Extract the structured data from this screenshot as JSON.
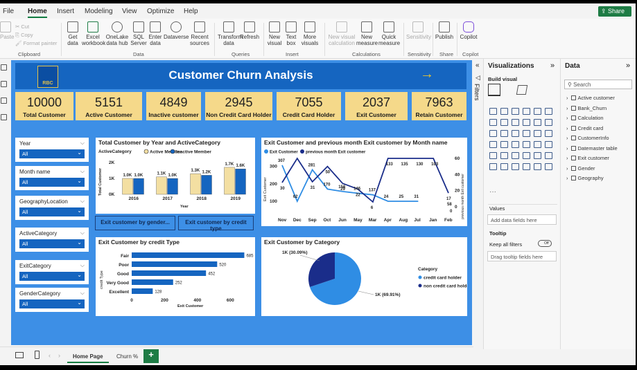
{
  "menu": {
    "file": "File",
    "home": "Home",
    "insert": "Insert",
    "modeling": "Modeling",
    "view": "View",
    "optimize": "Optimize",
    "help": "Help",
    "share": "Share"
  },
  "ribbon": {
    "clipboard": {
      "paste": "Paste",
      "cut": "Cut",
      "copy": "Copy",
      "format_painter": "Format painter",
      "group": "Clipboard"
    },
    "data": {
      "get_data": "Get data",
      "excel": "Excel workbook",
      "onelake": "OneLake data hub",
      "sql": "SQL Server",
      "enter": "Enter data",
      "dataverse": "Dataverse",
      "recent": "Recent sources",
      "group": "Data"
    },
    "queries": {
      "transform": "Transform data",
      "refresh": "Refresh",
      "group": "Queries"
    },
    "insert": {
      "new_visual": "New visual",
      "text_box": "Text box",
      "more_visuals": "More visuals",
      "group": "Insert"
    },
    "calculations": {
      "new_visual_calc": "New visual calculation",
      "new_measure": "New measure",
      "quick_measure": "Quick measure",
      "group": "Calculations"
    },
    "sensitivity": {
      "label": "Sensitivity",
      "group": "Sensitivity"
    },
    "share": {
      "publish": "Publish",
      "group": "Share"
    },
    "copilot": {
      "label": "Copilot",
      "group": "Copilot"
    }
  },
  "report": {
    "title": "Customer Churn Analysis",
    "logo_text": "RBC",
    "kpis": [
      {
        "value": "10000",
        "label": "Total Customer"
      },
      {
        "value": "5151",
        "label": "Active Customer"
      },
      {
        "value": "4849",
        "label": "Inactive customer"
      },
      {
        "value": "2945",
        "label": "Non Credit Card Holder"
      },
      {
        "value": "7055",
        "label": "Credit Card Holder"
      },
      {
        "value": "2037",
        "label": "Exit Customer"
      },
      {
        "value": "7963",
        "label": "Retain Customer"
      }
    ],
    "slicers": [
      {
        "title": "Year",
        "value": "All"
      },
      {
        "title": "Month name",
        "value": "All"
      },
      {
        "title": "GeographyLocation",
        "value": "All"
      },
      {
        "title": "ActiveCategory",
        "value": "All"
      },
      {
        "title": "ExitCategory",
        "value": "All"
      },
      {
        "title": "GenderCategory",
        "value": "All"
      }
    ],
    "buttons": {
      "by_gender": "Exit customer by gender...",
      "by_credit": "Exit customer by credit type"
    }
  },
  "chart_data": [
    {
      "type": "bar",
      "title": "Total Customer by Year and ActiveCategory",
      "legend_title": "ActiveCategory",
      "categories": [
        "2016",
        "2017",
        "2018",
        "2019"
      ],
      "series": [
        {
          "name": "Active Member",
          "values": [
            1.0,
            1.1,
            1.3,
            1.7
          ],
          "labels": [
            "1.0K",
            "1.1K",
            "1.3K",
            "1.7K"
          ],
          "color": "#f3dfa2"
        },
        {
          "name": "Inactive Member",
          "values": [
            1.0,
            1.0,
            1.2,
            1.6
          ],
          "labels": [
            "1.0K",
            "1.0K",
            "1.2K",
            "1.6K"
          ],
          "color": "#1565c0"
        }
      ],
      "xlabel": "Year",
      "ylabel": "Total Customer",
      "yticks": [
        "0K",
        "1K",
        "2K"
      ],
      "ylim": [
        0,
        2
      ]
    },
    {
      "type": "line",
      "title": "Exit Customer and previous month Exit customer by Month name",
      "categories": [
        "Nov",
        "Dec",
        "Sep",
        "Oct",
        "Jun",
        "May",
        "Mar",
        "Apr",
        "Aug",
        "Jul",
        "Jan",
        "Feb"
      ],
      "series": [
        {
          "name": "Exit Customer",
          "axis": "left",
          "values": [
            307,
            62,
            281,
            170,
            156,
            146,
            137,
            24,
            25,
            31,
            null,
            null
          ],
          "labels": [
            "307",
            "62",
            "281",
            "170",
            "156",
            "146",
            "137",
            "24",
            "25",
            "31",
            "",
            ""
          ],
          "color": "#2f8de4"
        },
        {
          "name": "previous month Exit customer",
          "axis": "right",
          "values": [
            30,
            62,
            31,
            50,
            29,
            22,
            6,
            133,
            135,
            130,
            103,
            17
          ],
          "labels": [
            "30",
            "",
            "31",
            "50",
            "29",
            "22",
            "6",
            "133",
            "135",
            "130",
            "103",
            "17"
          ],
          "color": "#1a2d8a"
        }
      ],
      "extra_labels": [
        "58",
        "0"
      ],
      "ylabel": "Exit Customer",
      "y2label": "previous month Exit customer",
      "yticks": [
        "100",
        "200",
        "300"
      ],
      "y2ticks": [
        "0",
        "20",
        "40",
        "60"
      ],
      "ylim": [
        100,
        300
      ],
      "y2lim": [
        0,
        60
      ]
    },
    {
      "type": "bar",
      "orientation": "horizontal",
      "title": "Exit Customer by credit Type",
      "categories": [
        "Fair",
        "Poor",
        "Good",
        "Very Good",
        "Excellent"
      ],
      "values": [
        685,
        520,
        452,
        252,
        128
      ],
      "xlabel": "Exit Customer",
      "ylabel": "credit Type",
      "xticks": [
        "0",
        "200",
        "400",
        "600"
      ],
      "xlim": [
        0,
        700
      ],
      "color": "#1565c0"
    },
    {
      "type": "pie",
      "title": "Exit Customer by Category",
      "legend_title": "Category",
      "slices": [
        {
          "name": "credit card holder",
          "value": 69.91,
          "label": "1K (69.91%)",
          "color": "#2f8de4"
        },
        {
          "name": "non credit card holder",
          "value": 30.09,
          "label": "1K (30.09%)",
          "color": "#1a2d8a"
        }
      ]
    }
  ],
  "panes": {
    "filters": "Filters",
    "visualizations": "Visualizations",
    "build_visual": "Build visual",
    "values": "Values",
    "values_placeholder": "Add data fields here",
    "tooltip": "Tooltip",
    "keep_filters": "Keep all filters",
    "toggle": "Off",
    "tooltip_placeholder": "Drag tooltip fields here",
    "data": "Data",
    "search": "Search",
    "fields": [
      "Active customer",
      "Bank_Churn",
      "Calculation",
      "Credit card",
      "CustomerInfo",
      "Datemaster table",
      "Exit customer",
      "Gender",
      "Geography"
    ]
  },
  "tabs": {
    "home": "Home Page",
    "churn": "Churn %",
    "add": "+"
  }
}
